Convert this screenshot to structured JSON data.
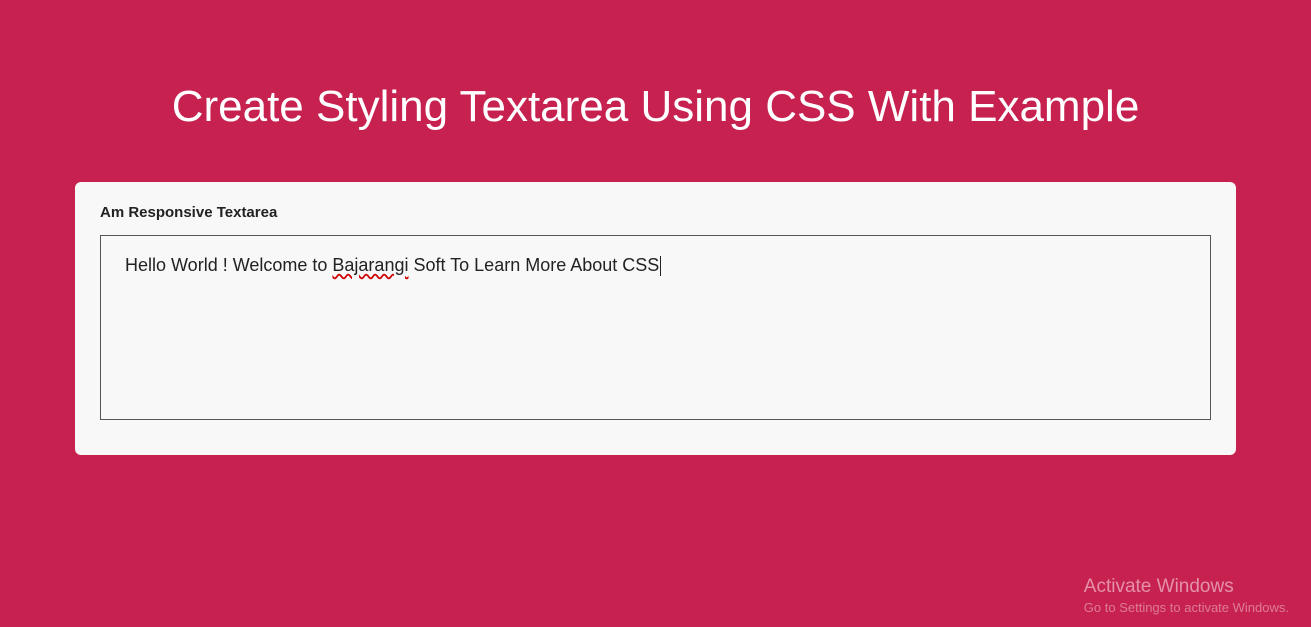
{
  "page": {
    "title": "Create Styling Textarea Using CSS With Example"
  },
  "form": {
    "label": "Am Responsive Textarea",
    "textarea": {
      "value_before": "Hello World ! Welcome to ",
      "spellcheck_word": "Bajarangi",
      "value_after": " Soft To Learn More About CSS",
      "full_value": "Hello World ! Welcome to Bajarangi Soft To Learn More About CSS"
    }
  },
  "watermark": {
    "title": "Activate Windows",
    "subtitle": "Go to Settings to activate Windows."
  }
}
